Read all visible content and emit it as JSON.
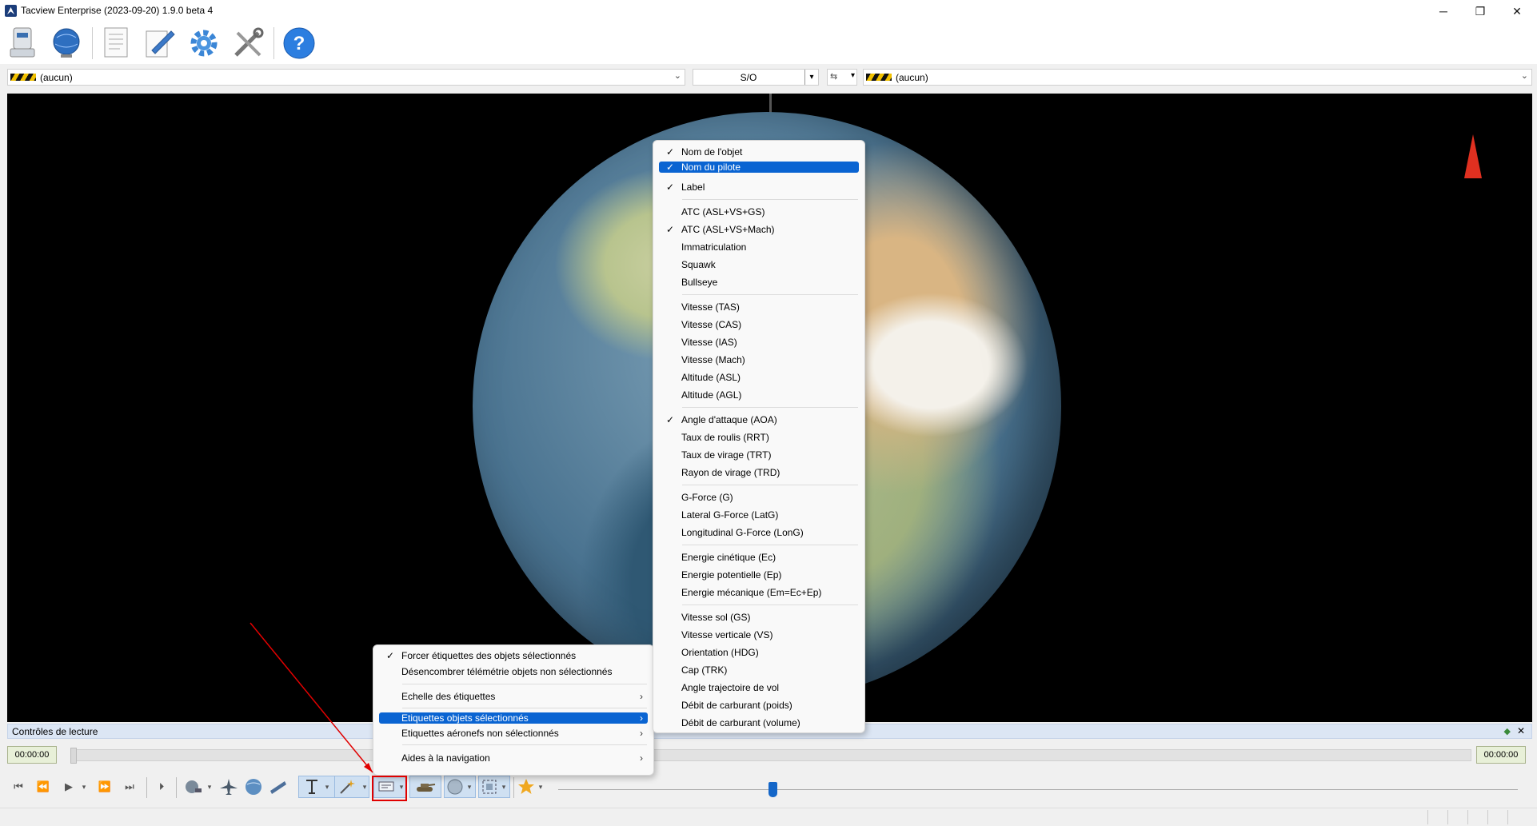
{
  "window": {
    "title": "Tacview Enterprise (2023-09-20) 1.9.0 beta 4",
    "controls": {
      "minimize": "─",
      "restore": "❐",
      "close": "✕"
    }
  },
  "toolbar": {
    "icons": [
      "recorder-icon",
      "globe-network-icon",
      "document-icon",
      "edit-icon",
      "settings-icon",
      "tools-icon",
      "help-icon"
    ]
  },
  "selectors": {
    "primary_object": "(aucun)",
    "relation": "S/O",
    "secondary_object": "(aucun)"
  },
  "playback": {
    "panel_title": "Contrôles de lecture",
    "start_time": "00:00:00",
    "end_time": "00:00:00"
  },
  "left_menu": {
    "items": [
      {
        "label": "Forcer étiquettes des objets sélectionnés",
        "checked": true
      },
      {
        "label": "Désencombrer télémétrie objets non sélectionnés",
        "checked": false
      },
      {
        "label": "Echelle des étiquettes",
        "submenu": true
      },
      {
        "label": "Etiquettes objets sélectionnés",
        "submenu": true,
        "highlighted": true
      },
      {
        "label": "Etiquettes aéronefs non sélectionnés",
        "submenu": true
      },
      {
        "label": "Aides à la navigation",
        "submenu": true
      }
    ]
  },
  "right_menu": {
    "items": [
      {
        "label": "Nom de l'objet",
        "checked": true
      },
      {
        "label": "Nom du pilote",
        "checked": true,
        "highlighted": true
      },
      {
        "label": "Label",
        "checked": true
      },
      {
        "label": "ATC (ASL+VS+GS)",
        "checked": false
      },
      {
        "label": "ATC (ASL+VS+Mach)",
        "checked": true
      },
      {
        "label": "Immatriculation",
        "checked": false
      },
      {
        "label": "Squawk",
        "checked": false
      },
      {
        "label": "Bullseye",
        "checked": false
      },
      {
        "label": "Vitesse (TAS)",
        "checked": false
      },
      {
        "label": "Vitesse (CAS)",
        "checked": false
      },
      {
        "label": "Vitesse (IAS)",
        "checked": false
      },
      {
        "label": "Vitesse (Mach)",
        "checked": false
      },
      {
        "label": "Altitude (ASL)",
        "checked": false
      },
      {
        "label": "Altitude (AGL)",
        "checked": false
      },
      {
        "label": "Angle d'attaque (AOA)",
        "checked": true
      },
      {
        "label": "Taux de roulis (RRT)",
        "checked": false
      },
      {
        "label": "Taux de virage (TRT)",
        "checked": false
      },
      {
        "label": "Rayon de virage (TRD)",
        "checked": false
      },
      {
        "label": "G-Force (G)",
        "checked": false
      },
      {
        "label": "Lateral G-Force (LatG)",
        "checked": false
      },
      {
        "label": "Longitudinal G-Force (LonG)",
        "checked": false
      },
      {
        "label": "Energie cinétique (Ec)",
        "checked": false
      },
      {
        "label": "Energie potentielle (Ep)",
        "checked": false
      },
      {
        "label": "Energie mécanique (Em=Ec+Ep)",
        "checked": false
      },
      {
        "label": "Vitesse sol (GS)",
        "checked": false
      },
      {
        "label": "Vitesse verticale (VS)",
        "checked": false
      },
      {
        "label": "Orientation (HDG)",
        "checked": false
      },
      {
        "label": "Cap (TRK)",
        "checked": false
      },
      {
        "label": "Angle trajectoire de vol",
        "checked": false
      },
      {
        "label": "Débit de carburant (poids)",
        "checked": false
      },
      {
        "label": "Débit de carburant (volume)",
        "checked": false
      }
    ]
  },
  "symbols": {
    "check": "✓",
    "submenu_arrow": "›",
    "dropdown": "⌄"
  },
  "colors": {
    "highlight": "#0a64d2",
    "annotation": "#e00000",
    "timebox": "#e8f0d8"
  }
}
